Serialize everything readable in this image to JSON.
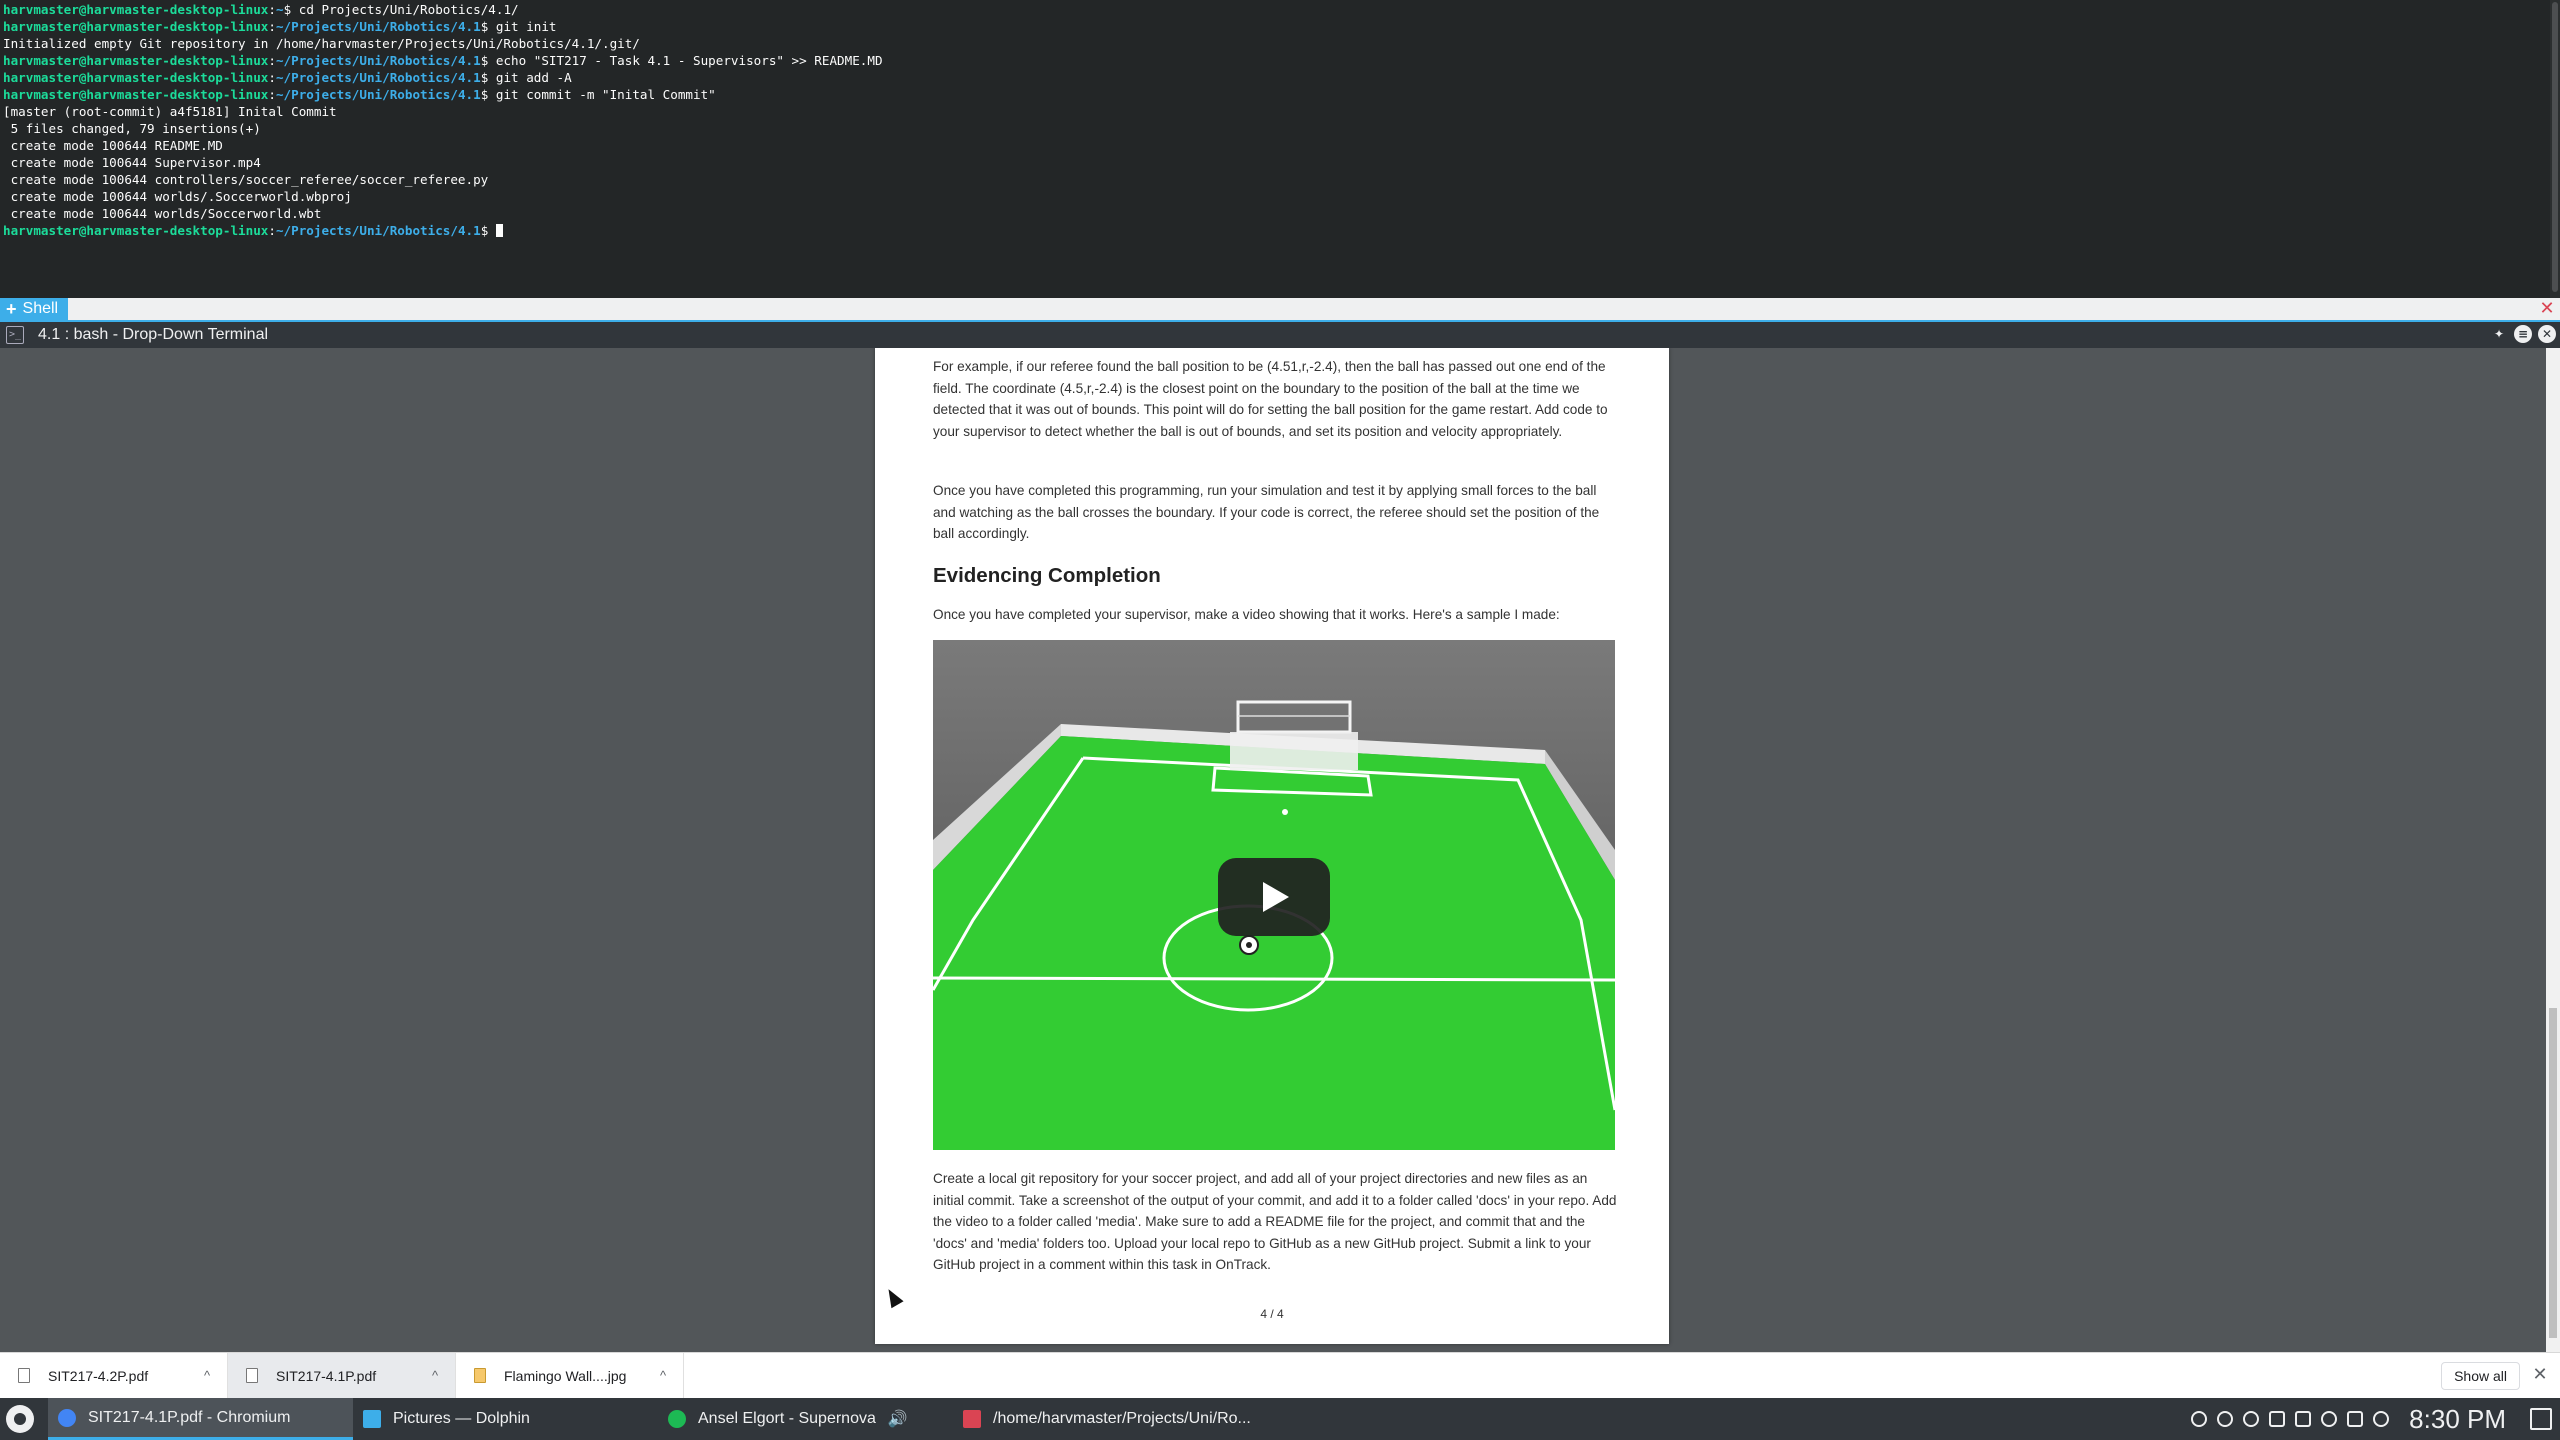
{
  "terminal": {
    "lines": [
      {
        "prompt_user": "harvmaster@harvmaster-desktop-linux",
        "prompt_sep": ":",
        "prompt_path": "~",
        "prompt_end": "$ ",
        "text": "cd Projects/Uni/Robotics/4.1/"
      },
      {
        "prompt_user": "harvmaster@harvmaster-desktop-linux",
        "prompt_sep": ":",
        "prompt_path": "~/Projects/Uni/Robotics/4.1",
        "prompt_end": "$ ",
        "text": "git init"
      },
      {
        "text": "Initialized empty Git repository in /home/harvmaster/Projects/Uni/Robotics/4.1/.git/"
      },
      {
        "prompt_user": "harvmaster@harvmaster-desktop-linux",
        "prompt_sep": ":",
        "prompt_path": "~/Projects/Uni/Robotics/4.1",
        "prompt_end": "$ ",
        "text": "echo \"SIT217 - Task 4.1 - Supervisors\" >> README.MD"
      },
      {
        "prompt_user": "harvmaster@harvmaster-desktop-linux",
        "prompt_sep": ":",
        "prompt_path": "~/Projects/Uni/Robotics/4.1",
        "prompt_end": "$ ",
        "text": "git add -A"
      },
      {
        "prompt_user": "harvmaster@harvmaster-desktop-linux",
        "prompt_sep": ":",
        "prompt_path": "~/Projects/Uni/Robotics/4.1",
        "prompt_end": "$ ",
        "text": "git commit -m \"Inital Commit\""
      },
      {
        "text": "[master (root-commit) a4f5181] Inital Commit"
      },
      {
        "text": " 5 files changed, 79 insertions(+)"
      },
      {
        "text": " create mode 100644 README.MD"
      },
      {
        "text": " create mode 100644 Supervisor.mp4"
      },
      {
        "text": " create mode 100644 controllers/soccer_referee/soccer_referee.py"
      },
      {
        "text": " create mode 100644 worlds/.Soccerworld.wbproj"
      },
      {
        "text": " create mode 100644 worlds/Soccerworld.wbt"
      },
      {
        "prompt_user": "harvmaster@harvmaster-desktop-linux",
        "prompt_sep": ":",
        "prompt_path": "~/Projects/Uni/Robotics/4.1",
        "prompt_end": "$ ",
        "text": "",
        "cursor": true
      }
    ],
    "tab_label": "Shell",
    "tab_icon": "+",
    "window_title": "4.1 : bash - Drop-Down Terminal"
  },
  "pdf": {
    "paragraph_1": "For example, if our referee found the ball position to be (4.51,r,-2.4), then the ball has passed out one end of the field. The coordinate (4.5,r,-2.4) is the closest point on the boundary to the position of the ball at the time we detected that it was out of bounds. This point will do for setting the ball position for the game restart. Add code to your supervisor to detect whether the ball is out of bounds, and set its position and velocity appropriately.",
    "paragraph_2": "Once you have completed this programming, run your simulation and test it by applying small forces to the ball and watching as the ball crosses the boundary. If your code is correct, the referee should set the position of the ball accordingly.",
    "heading": "Evidencing Completion",
    "paragraph_3": "Once you have completed your supervisor, make a video showing that it works. Here's a sample I made:",
    "paragraph_4": "Create a local git repository for your soccer project, and add all of your project directories and new files as an initial commit. Take a screenshot of the output of your commit, and add it to a folder called 'docs' in your repo. Add the video to a folder called 'media'. Make sure to add a README file for the project, and commit that and the 'docs' and 'media' folders too. Upload your local repo to GitHub as a new GitHub project. Submit a link to your GitHub project in a comment within this task in OnTrack.",
    "page_number": "4 / 4"
  },
  "downloads": {
    "items": [
      {
        "name": "SIT217-4.2P.pdf",
        "icon": "pdf-file-icon"
      },
      {
        "name": "SIT217-4.1P.pdf",
        "icon": "pdf-file-icon"
      },
      {
        "name": "Flamingo Wall....jpg",
        "icon": "image-file-icon"
      }
    ],
    "chevron": "^",
    "show_all": "Show all",
    "close": "✕"
  },
  "taskbar": {
    "tasks": [
      {
        "label": "SIT217-4.1P.pdf - Chromium",
        "icon": "chromium-icon",
        "color": "#4285f4"
      },
      {
        "label": "Pictures — Dolphin",
        "icon": "dolphin-folder-icon",
        "color": "#3daee9"
      },
      {
        "label": "Ansel Elgort - Supernova",
        "icon": "spotify-icon",
        "color": "#1db954"
      },
      {
        "label": "/home/harvmaster/Projects/Uni/Ro...",
        "icon": "konsole-icon",
        "color": "#da4453"
      }
    ],
    "audio_indicator": "🔊",
    "clock": "8:30 PM"
  }
}
